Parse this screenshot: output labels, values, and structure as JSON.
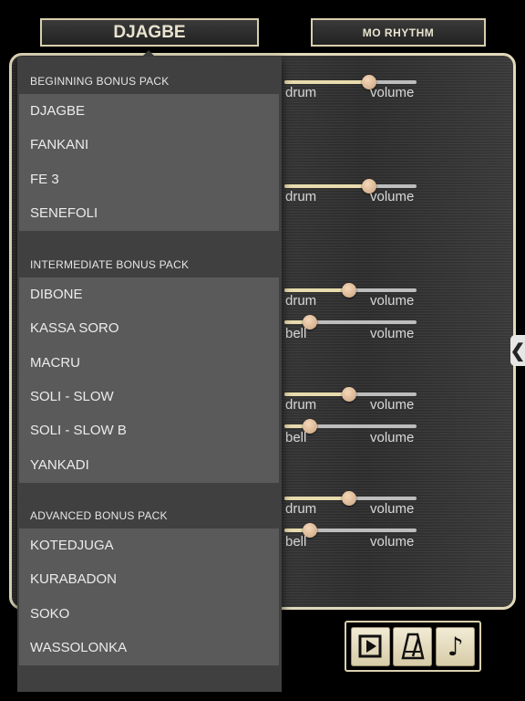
{
  "header": {
    "rhythm_name": "DJAGBE",
    "logo_prefix": "MO",
    "logo_suffix": "RHYTHM"
  },
  "mixer": {
    "rows": [
      {
        "label": "drum",
        "value_label": "volume",
        "level": 0.64
      },
      {
        "label": "drum",
        "value_label": "volume",
        "level": 0.64
      },
      {
        "label": "drum",
        "value_label": "volume",
        "level": 0.49
      },
      {
        "label": "bell",
        "value_label": "volume",
        "level": 0.19
      },
      {
        "label": "drum",
        "value_label": "volume",
        "level": 0.49
      },
      {
        "label": "bell",
        "value_label": "volume",
        "level": 0.19
      },
      {
        "label": "drum",
        "value_label": "volume",
        "level": 0.49
      },
      {
        "label": "bell",
        "value_label": "volume",
        "level": 0.19
      }
    ]
  },
  "menu": {
    "sections": [
      {
        "title": "BEGINNING BONUS PACK",
        "items": [
          "DJAGBE",
          "FANKANI",
          "FE 3",
          "SENEFOLI"
        ]
      },
      {
        "title": "INTERMEDIATE BONUS PACK",
        "items": [
          "DIBONE",
          "KASSA SORO",
          "MACRU",
          "SOLI - SLOW",
          "SOLI - SLOW B",
          "YANKADI"
        ]
      },
      {
        "title": "ADVANCED BONUS PACK",
        "items": [
          "KOTEDJUGA",
          "KURABADON",
          "SOKO",
          "WASSOLONKA"
        ]
      }
    ]
  },
  "transport": {
    "buttons": [
      "play-icon",
      "metronome-icon",
      "music-note-icon"
    ]
  },
  "collapse_tab": {
    "glyph": "❮"
  },
  "colors": {
    "accent": "#e2d9bb",
    "knob": "#d8b594"
  }
}
